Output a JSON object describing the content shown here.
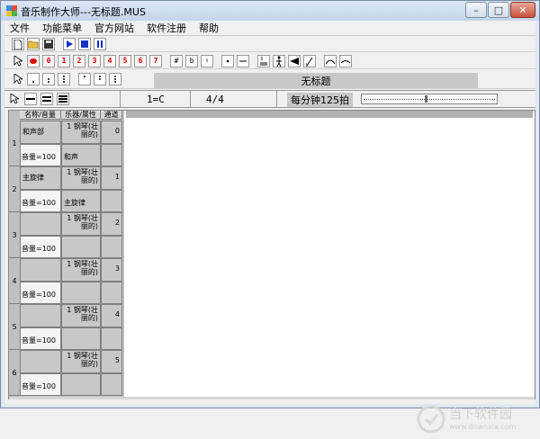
{
  "window": {
    "title": "音乐制作大师---无标题.MUS",
    "minimize": "–",
    "maximize": "□",
    "close": "✕"
  },
  "menu": [
    "文件",
    "功能菜单",
    "官方网站",
    "软件注册",
    "帮助"
  ],
  "toolbar1": [
    "new-icon",
    "open-icon",
    "save-icon",
    "play-icon",
    "stop-icon",
    "pause-icon"
  ],
  "toolbar2": {
    "numbers": [
      "0",
      "1",
      "2",
      "3",
      "4",
      "5",
      "6",
      "7"
    ],
    "accidentals": [
      "#",
      "b",
      "♮"
    ]
  },
  "toolbar4": {
    "key": "1=C",
    "time": "4/4",
    "tempo": "每分钟125拍"
  },
  "score_title": "无标题",
  "table": {
    "headers": [
      "名称/音量",
      "乐器/属性",
      "通道"
    ],
    "tracks": [
      {
        "num": "1",
        "name": "和声部",
        "instrument": "1 钢琴(壮丽的)",
        "channel": "0",
        "volume": "音量=100",
        "attr": "和声"
      },
      {
        "num": "2",
        "name": "主旋律",
        "instrument": "1 钢琴(壮丽的)",
        "channel": "1",
        "volume": "音量=100",
        "attr": "主旋律"
      },
      {
        "num": "3",
        "name": "",
        "instrument": "1 钢琴(壮丽的)",
        "channel": "2",
        "volume": "音量=100",
        "attr": ""
      },
      {
        "num": "4",
        "name": "",
        "instrument": "1 钢琴(壮丽的)",
        "channel": "3",
        "volume": "音量=100",
        "attr": ""
      },
      {
        "num": "5",
        "name": "",
        "instrument": "1 钢琴(壮丽的)",
        "channel": "4",
        "volume": "音量=100",
        "attr": ""
      },
      {
        "num": "6",
        "name": "",
        "instrument": "1 钢琴(壮丽的)",
        "channel": "5",
        "volume": "音量=100",
        "attr": ""
      }
    ]
  },
  "watermark": {
    "line1": "当下软件园",
    "line2": "www.downxia.com"
  }
}
